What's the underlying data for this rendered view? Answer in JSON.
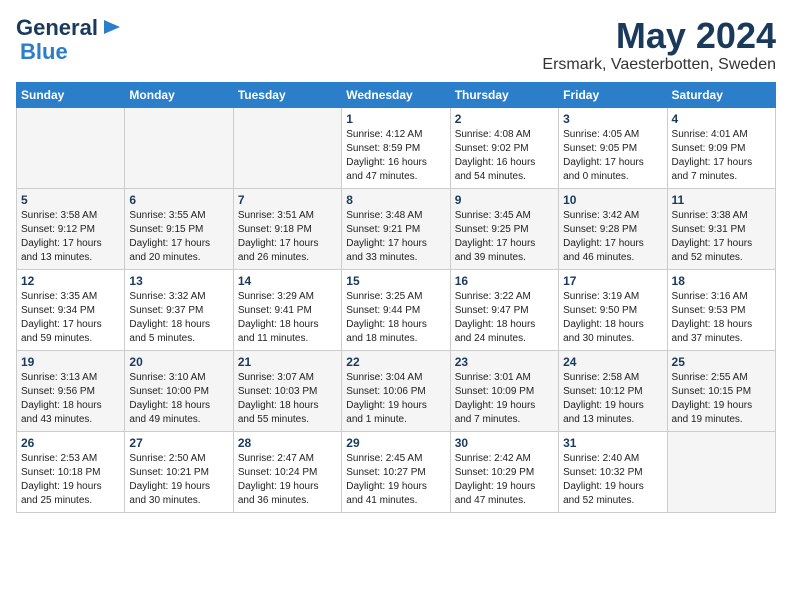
{
  "logo": {
    "line1": "General",
    "line2": "Blue"
  },
  "title": "May 2024",
  "subtitle": "Ersmark, Vaesterbotten, Sweden",
  "weekdays": [
    "Sunday",
    "Monday",
    "Tuesday",
    "Wednesday",
    "Thursday",
    "Friday",
    "Saturday"
  ],
  "weeks": [
    [
      {
        "day": "",
        "info": ""
      },
      {
        "day": "",
        "info": ""
      },
      {
        "day": "",
        "info": ""
      },
      {
        "day": "1",
        "info": "Sunrise: 4:12 AM\nSunset: 8:59 PM\nDaylight: 16 hours\nand 47 minutes."
      },
      {
        "day": "2",
        "info": "Sunrise: 4:08 AM\nSunset: 9:02 PM\nDaylight: 16 hours\nand 54 minutes."
      },
      {
        "day": "3",
        "info": "Sunrise: 4:05 AM\nSunset: 9:05 PM\nDaylight: 17 hours\nand 0 minutes."
      },
      {
        "day": "4",
        "info": "Sunrise: 4:01 AM\nSunset: 9:09 PM\nDaylight: 17 hours\nand 7 minutes."
      }
    ],
    [
      {
        "day": "5",
        "info": "Sunrise: 3:58 AM\nSunset: 9:12 PM\nDaylight: 17 hours\nand 13 minutes."
      },
      {
        "day": "6",
        "info": "Sunrise: 3:55 AM\nSunset: 9:15 PM\nDaylight: 17 hours\nand 20 minutes."
      },
      {
        "day": "7",
        "info": "Sunrise: 3:51 AM\nSunset: 9:18 PM\nDaylight: 17 hours\nand 26 minutes."
      },
      {
        "day": "8",
        "info": "Sunrise: 3:48 AM\nSunset: 9:21 PM\nDaylight: 17 hours\nand 33 minutes."
      },
      {
        "day": "9",
        "info": "Sunrise: 3:45 AM\nSunset: 9:25 PM\nDaylight: 17 hours\nand 39 minutes."
      },
      {
        "day": "10",
        "info": "Sunrise: 3:42 AM\nSunset: 9:28 PM\nDaylight: 17 hours\nand 46 minutes."
      },
      {
        "day": "11",
        "info": "Sunrise: 3:38 AM\nSunset: 9:31 PM\nDaylight: 17 hours\nand 52 minutes."
      }
    ],
    [
      {
        "day": "12",
        "info": "Sunrise: 3:35 AM\nSunset: 9:34 PM\nDaylight: 17 hours\nand 59 minutes."
      },
      {
        "day": "13",
        "info": "Sunrise: 3:32 AM\nSunset: 9:37 PM\nDaylight: 18 hours\nand 5 minutes."
      },
      {
        "day": "14",
        "info": "Sunrise: 3:29 AM\nSunset: 9:41 PM\nDaylight: 18 hours\nand 11 minutes."
      },
      {
        "day": "15",
        "info": "Sunrise: 3:25 AM\nSunset: 9:44 PM\nDaylight: 18 hours\nand 18 minutes."
      },
      {
        "day": "16",
        "info": "Sunrise: 3:22 AM\nSunset: 9:47 PM\nDaylight: 18 hours\nand 24 minutes."
      },
      {
        "day": "17",
        "info": "Sunrise: 3:19 AM\nSunset: 9:50 PM\nDaylight: 18 hours\nand 30 minutes."
      },
      {
        "day": "18",
        "info": "Sunrise: 3:16 AM\nSunset: 9:53 PM\nDaylight: 18 hours\nand 37 minutes."
      }
    ],
    [
      {
        "day": "19",
        "info": "Sunrise: 3:13 AM\nSunset: 9:56 PM\nDaylight: 18 hours\nand 43 minutes."
      },
      {
        "day": "20",
        "info": "Sunrise: 3:10 AM\nSunset: 10:00 PM\nDaylight: 18 hours\nand 49 minutes."
      },
      {
        "day": "21",
        "info": "Sunrise: 3:07 AM\nSunset: 10:03 PM\nDaylight: 18 hours\nand 55 minutes."
      },
      {
        "day": "22",
        "info": "Sunrise: 3:04 AM\nSunset: 10:06 PM\nDaylight: 19 hours\nand 1 minute."
      },
      {
        "day": "23",
        "info": "Sunrise: 3:01 AM\nSunset: 10:09 PM\nDaylight: 19 hours\nand 7 minutes."
      },
      {
        "day": "24",
        "info": "Sunrise: 2:58 AM\nSunset: 10:12 PM\nDaylight: 19 hours\nand 13 minutes."
      },
      {
        "day": "25",
        "info": "Sunrise: 2:55 AM\nSunset: 10:15 PM\nDaylight: 19 hours\nand 19 minutes."
      }
    ],
    [
      {
        "day": "26",
        "info": "Sunrise: 2:53 AM\nSunset: 10:18 PM\nDaylight: 19 hours\nand 25 minutes."
      },
      {
        "day": "27",
        "info": "Sunrise: 2:50 AM\nSunset: 10:21 PM\nDaylight: 19 hours\nand 30 minutes."
      },
      {
        "day": "28",
        "info": "Sunrise: 2:47 AM\nSunset: 10:24 PM\nDaylight: 19 hours\nand 36 minutes."
      },
      {
        "day": "29",
        "info": "Sunrise: 2:45 AM\nSunset: 10:27 PM\nDaylight: 19 hours\nand 41 minutes."
      },
      {
        "day": "30",
        "info": "Sunrise: 2:42 AM\nSunset: 10:29 PM\nDaylight: 19 hours\nand 47 minutes."
      },
      {
        "day": "31",
        "info": "Sunrise: 2:40 AM\nSunset: 10:32 PM\nDaylight: 19 hours\nand 52 minutes."
      },
      {
        "day": "",
        "info": ""
      }
    ]
  ]
}
